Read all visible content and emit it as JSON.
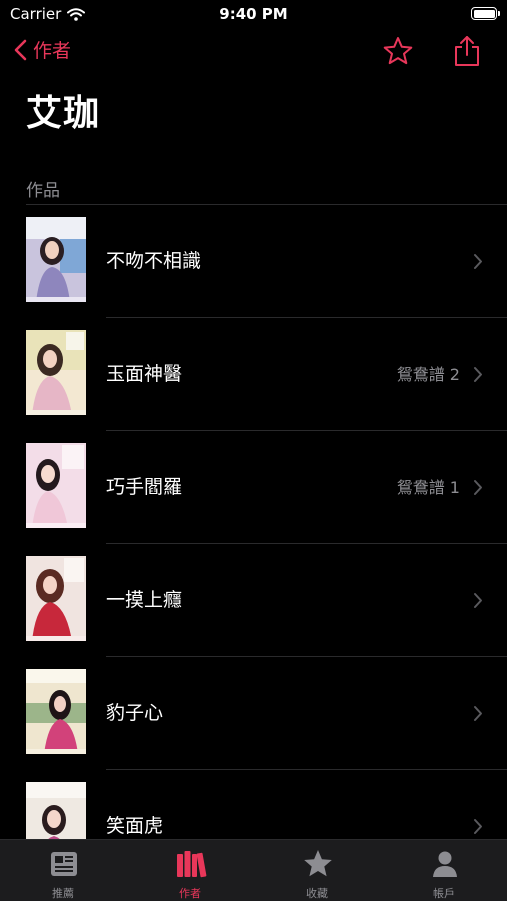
{
  "status": {
    "carrier": "Carrier",
    "time": "9:40 PM"
  },
  "nav": {
    "back_label": "作者"
  },
  "author": {
    "name": "艾珈"
  },
  "section": {
    "header": "作品"
  },
  "books": [
    {
      "title": "不吻不相識",
      "series": ""
    },
    {
      "title": "玉面神醫",
      "series": "鴛鴦譜 2"
    },
    {
      "title": "巧手閻羅",
      "series": "鴛鴦譜 1"
    },
    {
      "title": "一摸上癮",
      "series": ""
    },
    {
      "title": "豹子心",
      "series": ""
    },
    {
      "title": "笑面虎",
      "series": ""
    }
  ],
  "tabs": [
    {
      "label": "推薦",
      "icon": "newspaper-icon",
      "active": false
    },
    {
      "label": "作者",
      "icon": "books-icon",
      "active": true
    },
    {
      "label": "收藏",
      "icon": "star-icon",
      "active": false
    },
    {
      "label": "帳戶",
      "icon": "person-icon",
      "active": false
    }
  ],
  "colors": {
    "accent": "#e8375a",
    "secondary_text": "#8d8d92",
    "tab_bar": "#1c1c1e"
  }
}
